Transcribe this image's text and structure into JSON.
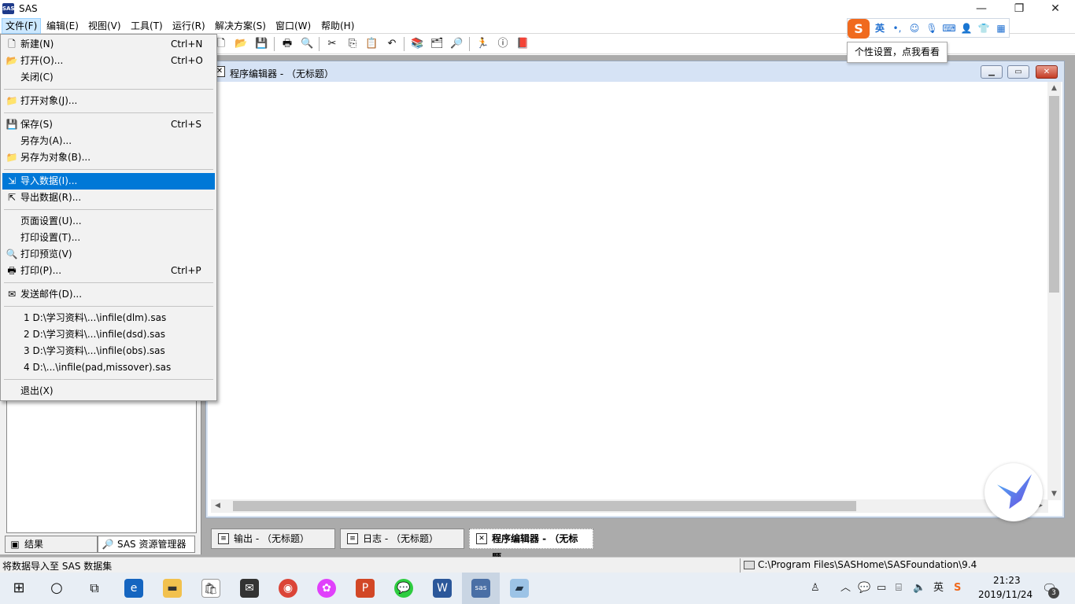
{
  "title_bar": {
    "app_logo": "SAS",
    "title": "SAS",
    "minimize": "—",
    "restore": "❐",
    "close": "✕"
  },
  "menubar": [
    {
      "label": "文件(F)"
    },
    {
      "label": "编辑(E)"
    },
    {
      "label": "视图(V)"
    },
    {
      "label": "工具(T)"
    },
    {
      "label": "运行(R)"
    },
    {
      "label": "解决方案(S)"
    },
    {
      "label": "窗口(W)"
    },
    {
      "label": "帮助(H)"
    }
  ],
  "file_menu": {
    "items": [
      {
        "label": "新建(N)",
        "shortcut": "Ctrl+N",
        "icon": "new-file-icon"
      },
      {
        "label": "打开(O)...",
        "shortcut": "Ctrl+O",
        "icon": "open-folder-icon"
      },
      {
        "label": "关闭(C)",
        "shortcut": "",
        "icon": ""
      },
      {
        "label": "打开对象(J)...",
        "shortcut": "",
        "icon": "open-object-icon"
      },
      {
        "label": "保存(S)",
        "shortcut": "Ctrl+S",
        "icon": "save-icon"
      },
      {
        "label": "另存为(A)...",
        "shortcut": "",
        "icon": ""
      },
      {
        "label": "另存为对象(B)...",
        "shortcut": "",
        "icon": "save-object-icon"
      },
      {
        "label": "导入数据(I)...",
        "shortcut": "",
        "icon": "import-data-icon"
      },
      {
        "label": "导出数据(R)...",
        "shortcut": "",
        "icon": "export-data-icon"
      },
      {
        "label": "页面设置(U)...",
        "shortcut": "",
        "icon": ""
      },
      {
        "label": "打印设置(T)...",
        "shortcut": "",
        "icon": ""
      },
      {
        "label": "打印预览(V)",
        "shortcut": "",
        "icon": "print-preview-icon"
      },
      {
        "label": "打印(P)...",
        "shortcut": "Ctrl+P",
        "icon": "print-icon"
      },
      {
        "label": "发送邮件(D)...",
        "shortcut": "",
        "icon": "send-mail-icon"
      },
      {
        "label": "1 D:\\学习资料\\...\\infile(dlm).sas",
        "shortcut": "",
        "icon": ""
      },
      {
        "label": "2 D:\\学习资料\\...\\infile(dsd).sas",
        "shortcut": "",
        "icon": ""
      },
      {
        "label": "3 D:\\学习资料\\...\\infile(obs).sas",
        "shortcut": "",
        "icon": ""
      },
      {
        "label": "4 D:\\...\\infile(pad,missover).sas",
        "shortcut": "",
        "icon": ""
      },
      {
        "label": "退出(X)",
        "shortcut": "",
        "icon": ""
      }
    ],
    "highlighted": "导入数据(I)..."
  },
  "toolbar": {
    "icons": [
      "new-icon",
      "open-icon",
      "save-icon",
      "print-icon",
      "print-preview-icon",
      "cut-icon",
      "copy-icon",
      "paste-icon",
      "undo-icon",
      "libraries-icon",
      "explorer-icon",
      "find-icon",
      "run-icon",
      "stop-icon",
      "help-book-icon"
    ]
  },
  "ime": {
    "logo": "S",
    "mode": "英",
    "punct": "•,",
    "emoji": "☺",
    "tooltip": "个性设置，点我看看"
  },
  "editor": {
    "title": "程序编辑器 - （无标题）"
  },
  "left_panel": {
    "tabs": [
      {
        "label": "结果"
      },
      {
        "label": "SAS 资源管理器"
      }
    ]
  },
  "window_tabs": [
    {
      "label": "输出 - （无标题）"
    },
    {
      "label": "日志 - （无标题）"
    },
    {
      "label": "程序编辑器 - （无标题..."
    }
  ],
  "status_bar": {
    "message": "将数据导入至 SAS 数据集",
    "path": "C:\\Program Files\\SASHome\\SASFoundation\\9.4"
  },
  "taskbar": {
    "tray_lang": "英",
    "time": "21:23",
    "date": "2019/11/24",
    "notification_count": "3"
  },
  "colors": {
    "menu_highlight": "#0078d7",
    "ime_orange": "#f06a1e",
    "workspace_gray": "#ababab"
  }
}
